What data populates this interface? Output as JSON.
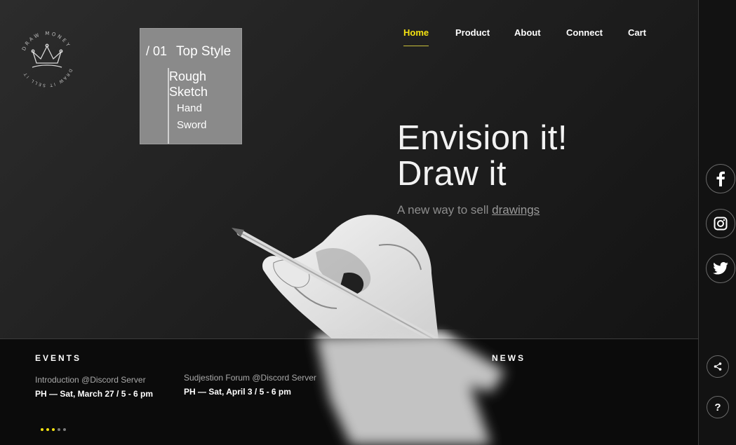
{
  "logo": {
    "top_text": "DRAW MONEY",
    "bottom_text": "DRAW IT SELL IT"
  },
  "style_card": {
    "number": "/ 01",
    "title": "Top Style",
    "options": [
      "Rough Sketch",
      "Hand",
      "Sword"
    ]
  },
  "nav": {
    "items": [
      {
        "label": "Home",
        "active": true
      },
      {
        "label": "Product",
        "active": false
      },
      {
        "label": "About",
        "active": false
      },
      {
        "label": "Connect",
        "active": false
      },
      {
        "label": "Cart",
        "active": false
      }
    ]
  },
  "hero": {
    "line1": "Envision it!",
    "line2": "Draw it",
    "subtitle_prefix": "A new way to sell ",
    "subtitle_link": "drawings"
  },
  "events": {
    "heading": "EVENTS",
    "items": [
      {
        "title": "Introduction @Discord Server",
        "date": "PH — Sat, March 27 / 5 - 6 pm"
      },
      {
        "title": "Sudjestion Forum @Discord Server",
        "date": "PH — Sat, April 3 / 5 - 6 pm"
      }
    ],
    "pager_active_count": 3,
    "pager_total": 5
  },
  "news": {
    "heading": "NEWS"
  },
  "social": [
    "facebook-icon",
    "instagram-icon",
    "twitter-icon"
  ],
  "utility": {
    "share_icon": "share-icon",
    "help_label": "?"
  },
  "colors": {
    "accent": "#f4e211",
    "background": "#1e1e1e",
    "card": "#8a8a8a"
  }
}
